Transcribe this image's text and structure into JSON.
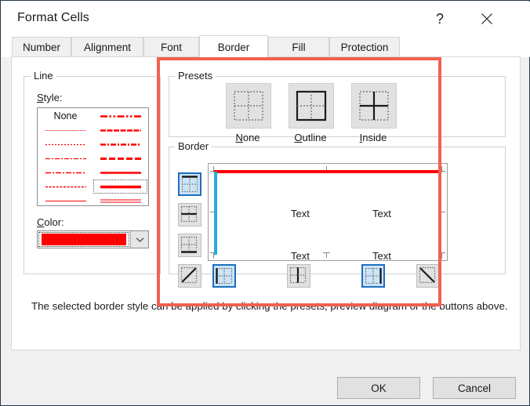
{
  "window": {
    "title": "Format Cells",
    "help_icon": "question-mark-icon",
    "help_label": "?",
    "close_icon": "close-icon"
  },
  "tabs": [
    {
      "label": "Number",
      "active": false
    },
    {
      "label": "Alignment",
      "active": false
    },
    {
      "label": "Font",
      "active": false
    },
    {
      "label": "Border",
      "active": true
    },
    {
      "label": "Fill",
      "active": false
    },
    {
      "label": "Protection",
      "active": false
    }
  ],
  "line_group": {
    "legend": "Line",
    "style_label": "Style:",
    "none_label": "None",
    "color_label": "Color:",
    "color_value": "#ff0000",
    "selected_style": "thick-solid",
    "styles": [
      {
        "name": "none",
        "pattern": "none"
      },
      {
        "name": "dash-dot-dot-thin",
        "pattern": "dash-dot-dot"
      },
      {
        "name": "fine-dotted",
        "pattern": "fine-dotted"
      },
      {
        "name": "dashed-medium",
        "pattern": "dashed-medium"
      },
      {
        "name": "dotted",
        "pattern": "dotted"
      },
      {
        "name": "dash-dot-medium",
        "pattern": "dash-dot"
      },
      {
        "name": "dashed-thin",
        "pattern": "dashed-thin"
      },
      {
        "name": "dashed-bold",
        "pattern": "dashed-bold"
      },
      {
        "name": "dash-dot-thin",
        "pattern": "dash-dot-thin"
      },
      {
        "name": "solid-thick",
        "pattern": "solid-thick"
      },
      {
        "name": "dashed-fine",
        "pattern": "dashed-fine"
      },
      {
        "name": "thick-solid",
        "pattern": "thick-solid"
      },
      {
        "name": "hairline",
        "pattern": "hairline"
      },
      {
        "name": "double",
        "pattern": "double"
      }
    ]
  },
  "presets": {
    "legend": "Presets",
    "items": [
      {
        "label": "None",
        "accel": "N",
        "icon": "border-none-icon"
      },
      {
        "label": "Outline",
        "accel": "O",
        "icon": "border-outline-icon"
      },
      {
        "label": "Inside",
        "accel": "I",
        "icon": "border-inside-icon"
      }
    ]
  },
  "border": {
    "legend": "Border",
    "preview_cells": [
      "Text",
      "Text",
      "Text",
      "Text"
    ],
    "applied": {
      "top": {
        "color": "#ff0000",
        "width": "thick"
      },
      "left": {
        "color": "#29abe2",
        "width": "thick"
      },
      "right": {
        "color": "#29abe2",
        "width": "thick"
      }
    },
    "left_buttons": [
      {
        "name": "border-top-button",
        "icon": "border-top-icon",
        "pressed": true
      },
      {
        "name": "border-horizontal-inside-button",
        "icon": "border-horizontal-inside-icon",
        "pressed": false
      },
      {
        "name": "border-bottom-button",
        "icon": "border-bottom-icon",
        "pressed": false
      },
      {
        "name": "border-diagonal-up-button",
        "icon": "border-diagonal-up-icon",
        "pressed": false
      }
    ],
    "bottom_buttons": [
      {
        "name": "border-left-button",
        "icon": "border-left-icon",
        "pressed": true
      },
      {
        "name": "border-vertical-inside-button",
        "icon": "border-vertical-inside-icon",
        "pressed": false
      },
      {
        "name": "border-right-button",
        "icon": "border-right-icon",
        "pressed": true
      },
      {
        "name": "border-diagonal-down-button",
        "icon": "border-diagonal-down-icon",
        "pressed": false
      }
    ]
  },
  "note": "The selected border style can be applied by clicking the presets, preview diagram or the buttons above.",
  "footer": {
    "ok_label": "OK",
    "cancel_label": "Cancel"
  },
  "annotation": {
    "color": "#f4604f",
    "shape": "rectangle-highlight"
  }
}
